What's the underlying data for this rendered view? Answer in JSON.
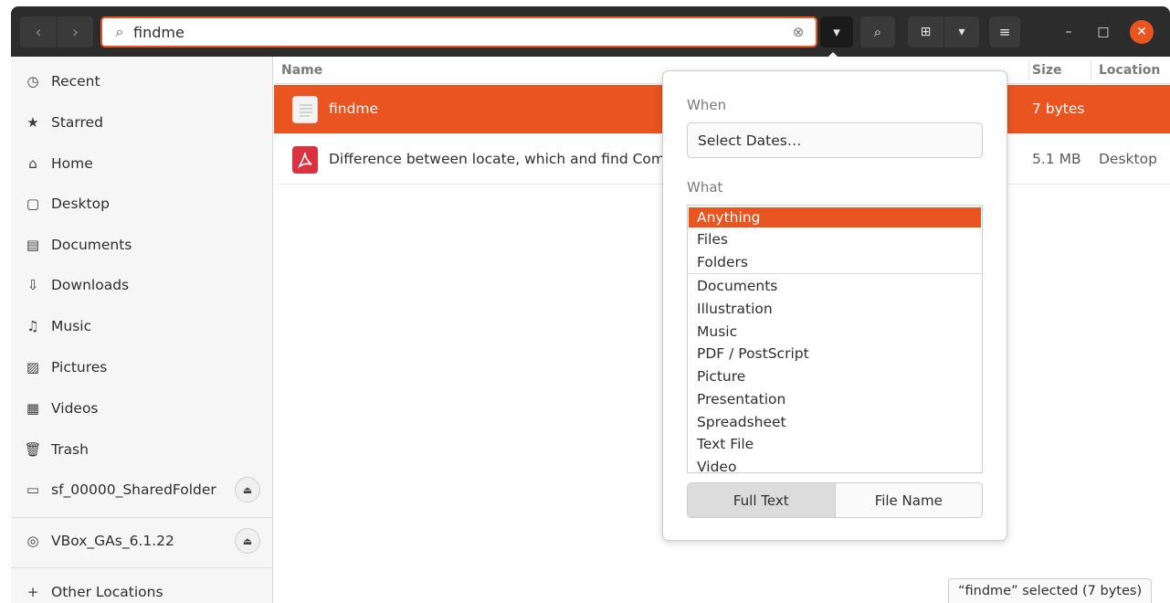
{
  "search": {
    "query": "findme"
  },
  "sidebar": {
    "items": [
      {
        "icon": "clock-icon",
        "glyph": "◷",
        "label": "Recent"
      },
      {
        "icon": "star-icon",
        "glyph": "★",
        "label": "Starred"
      },
      {
        "icon": "home-icon",
        "glyph": "⌂",
        "label": "Home"
      },
      {
        "icon": "desktop-icon",
        "glyph": "▢",
        "label": "Desktop"
      },
      {
        "icon": "documents-icon",
        "glyph": "▤",
        "label": "Documents"
      },
      {
        "icon": "downloads-icon",
        "glyph": "⇩",
        "label": "Downloads"
      },
      {
        "icon": "music-icon",
        "glyph": "♫",
        "label": "Music"
      },
      {
        "icon": "pictures-icon",
        "glyph": "▨",
        "label": "Pictures"
      },
      {
        "icon": "videos-icon",
        "glyph": "▦",
        "label": "Videos"
      },
      {
        "icon": "trash-icon",
        "glyph": "🗑",
        "label": "Trash"
      },
      {
        "icon": "drive-icon",
        "glyph": "▭",
        "label": "sf_00000_SharedFolder"
      },
      {
        "icon": "disc-icon",
        "glyph": "◎",
        "label": "VBox_GAs_6.1.22"
      },
      {
        "icon": "plus-icon",
        "glyph": "+",
        "label": "Other Locations"
      }
    ]
  },
  "columns": {
    "name": "Name",
    "size": "Size",
    "location": "Location"
  },
  "files": [
    {
      "name": "findme",
      "size": "7 bytes",
      "location": ""
    },
    {
      "name": "Difference between locate, which and find Com",
      "ellipsis": "..",
      "size": "5.1 MB",
      "location": "Desktop"
    }
  ],
  "popover": {
    "when_label": "When",
    "date_button": "Select Dates…",
    "what_label": "What",
    "types": [
      "Anything",
      "Files",
      "Folders",
      "Documents",
      "Illustration",
      "Music",
      "PDF / PostScript",
      "Picture",
      "Presentation",
      "Spreadsheet",
      "Text File",
      "Video"
    ],
    "selected_type": "Anything",
    "mode_full_text": "Full Text",
    "mode_file_name": "File Name",
    "active_mode": "Full Text"
  },
  "status": "“findme” selected  (7 bytes)",
  "colors": {
    "accent": "#e95420",
    "header": "#2c2c2c",
    "sidebar": "#f6f6f6"
  }
}
